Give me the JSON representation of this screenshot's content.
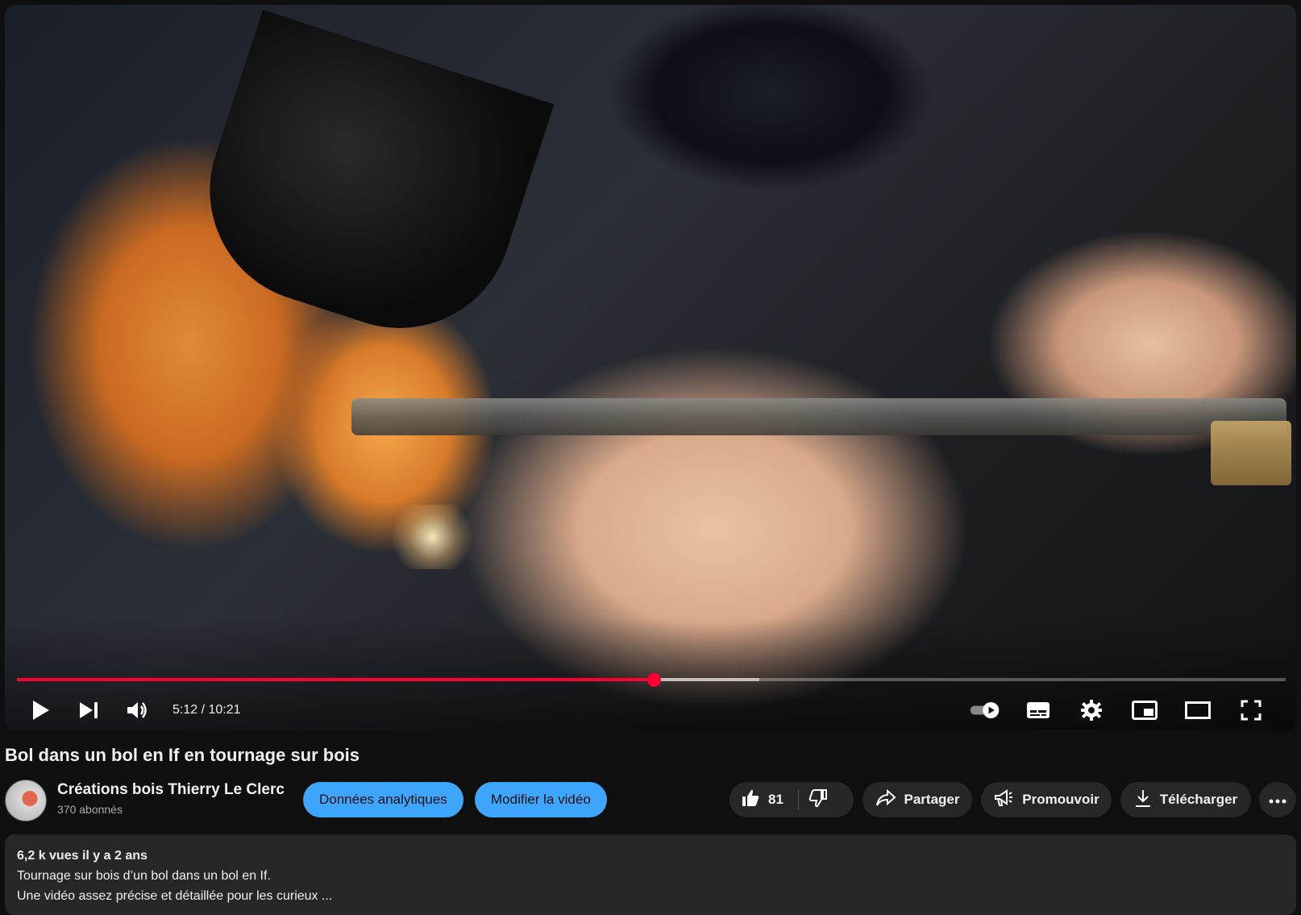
{
  "player": {
    "progress_fraction": 0.502,
    "buffered_fraction": 0.585,
    "time_display": "5:12 / 10:21",
    "icons": {
      "play": "play-icon",
      "next": "next-icon",
      "volume": "volume-icon",
      "autoplay": "autoplay-toggle-icon",
      "subtitles": "subtitles-icon",
      "settings": "settings-gear-icon",
      "miniplayer": "miniplayer-icon",
      "theater": "theater-mode-icon",
      "fullscreen": "fullscreen-icon"
    },
    "accent_color": "#ff0033"
  },
  "video": {
    "title": "Bol dans un bol en If en tournage sur bois"
  },
  "channel": {
    "name": "Créations bois Thierry Le Clerc",
    "subscribers": "370 abonnés"
  },
  "actions": {
    "analytics_label": "Données analytiques",
    "edit_label": "Modifier la vidéo",
    "like_count": "81",
    "share_label": "Partager",
    "promote_label": "Promouvoir",
    "download_label": "Télécharger",
    "button_color": "#3ea6ff"
  },
  "description": {
    "meta": "6,2 k vues  il y a 2 ans",
    "line1": "Tournage sur bois d’un bol dans un bol en If.",
    "line2": "Une vidéo assez précise et détaillée pour les curieux ..."
  }
}
